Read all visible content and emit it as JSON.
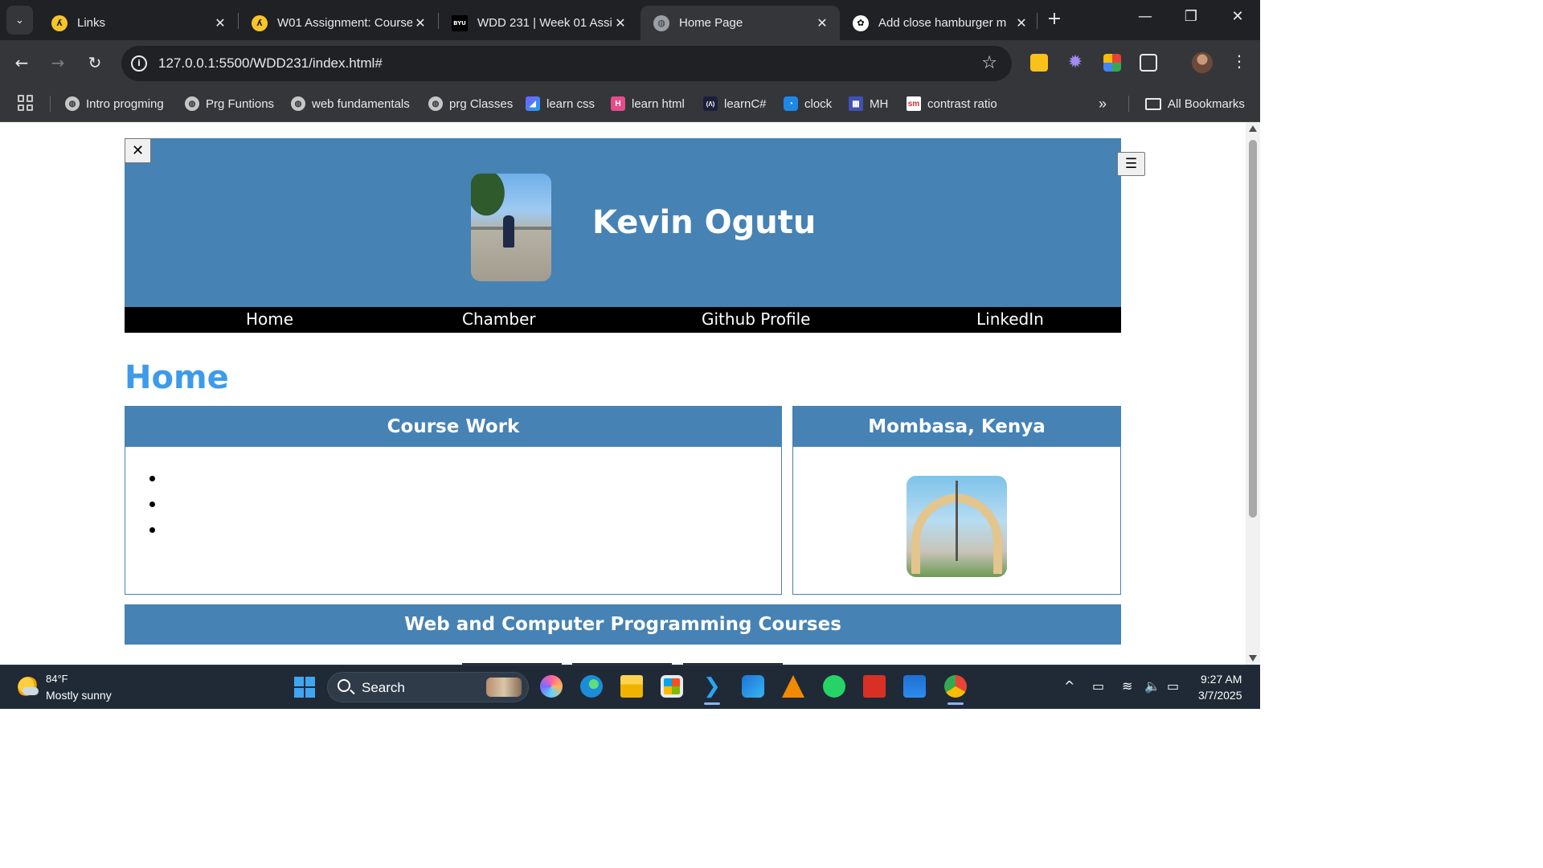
{
  "browser": {
    "tabs": [
      {
        "title": "Links",
        "active": false
      },
      {
        "title": "W01 Assignment: Course",
        "active": false
      },
      {
        "title": "WDD 231 | Week 01 Assi",
        "active": false
      },
      {
        "title": "Home Page",
        "active": true
      },
      {
        "title": "Add close hamburger m",
        "active": false
      }
    ],
    "url": "127.0.0.1:5500/WDD231/index.html#",
    "bookmarks": [
      {
        "label": "Intro progming",
        "icon": "globe-icon"
      },
      {
        "label": "Prg Funtions",
        "icon": "globe-icon"
      },
      {
        "label": "web fundamentals",
        "icon": "globe-icon"
      },
      {
        "label": "prg Classes",
        "icon": "globe-icon"
      },
      {
        "label": "learn css",
        "icon": "css-icon"
      },
      {
        "label": "learn html",
        "icon": "html-icon"
      },
      {
        "label": "learnC#",
        "icon": "csharp-icon"
      },
      {
        "label": "clock",
        "icon": "clock-icon"
      },
      {
        "label": "MH",
        "icon": "mh-icon"
      },
      {
        "label": "contrast ratio",
        "icon": "sm-icon"
      }
    ],
    "all_bookmarks": "All Bookmarks"
  },
  "site": {
    "close_glyph": "✕",
    "hamburger_glyph": "☰",
    "name": "Kevin Ogutu",
    "nav": [
      "Home",
      "Chamber",
      "Github Profile",
      "LinkedIn"
    ],
    "page_heading": "Home",
    "course_card_title": "Course Work",
    "course_items": [
      "",
      "",
      ""
    ],
    "place_card_title": "Mombasa, Kenya",
    "courses_banner": "Web and Computer Programming Courses"
  },
  "taskbar": {
    "temperature": "84°F",
    "weather": "Mostly sunny",
    "search_label": "Search",
    "time": "9:27 AM",
    "date": "3/7/2025"
  },
  "colors": {
    "header_blue": "#4682b4",
    "heading_blue": "#3d9be9",
    "nav_black": "#000000"
  }
}
